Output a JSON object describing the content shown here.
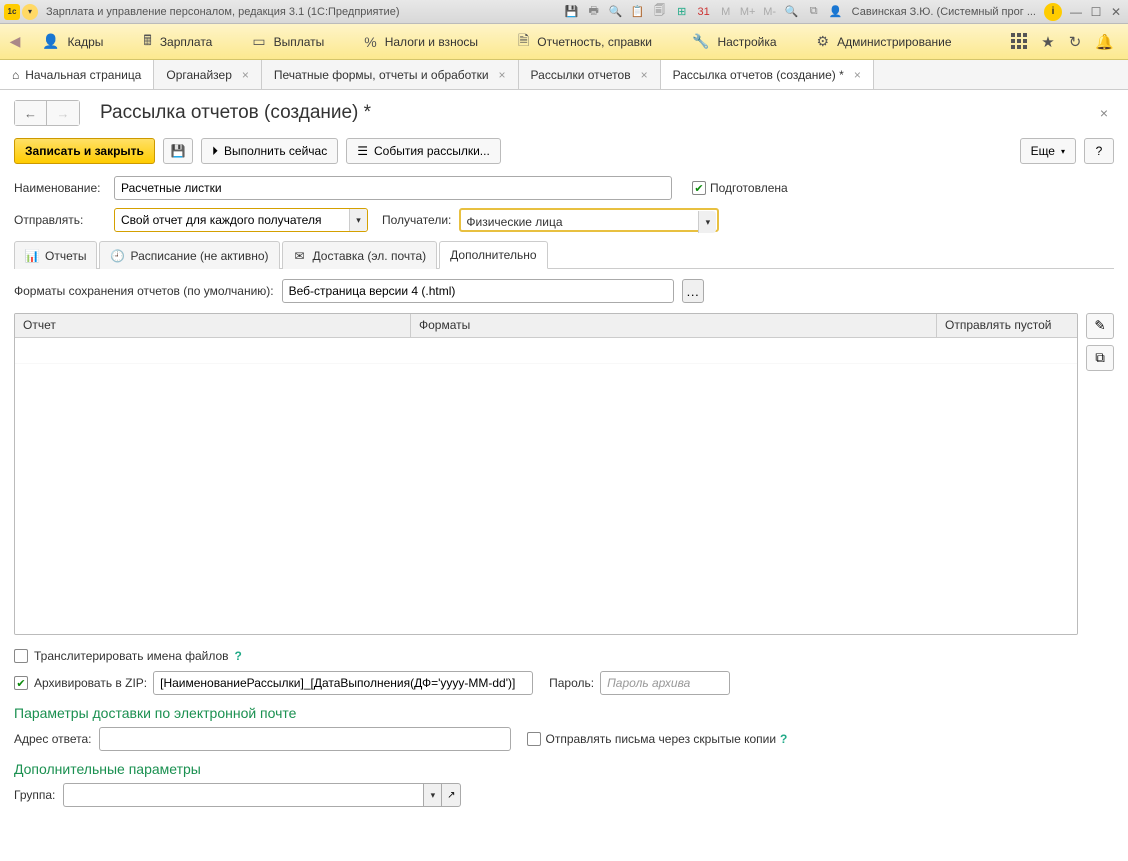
{
  "title_bar": {
    "app_title": "Зарплата и управление персоналом, редакция 3.1  (1С:Предприятие)",
    "user": "Савинская З.Ю. (Системный прог ..."
  },
  "menu": {
    "items": [
      "Кадры",
      "Зарплата",
      "Выплаты",
      "Налоги и взносы",
      "Отчетность, справки",
      "Настройка",
      "Администрирование"
    ]
  },
  "tabs": {
    "home": "Начальная страница",
    "items": [
      "Органайзер",
      "Печатные формы, отчеты и обработки",
      "Рассылки отчетов",
      "Рассылка отчетов (создание) *"
    ]
  },
  "header": {
    "page_title": "Рассылка отчетов (создание) *"
  },
  "toolbar": {
    "save_close": "Записать и закрыть",
    "run_now": "Выполнить сейчас",
    "events": "События рассылки...",
    "more": "Еще"
  },
  "form": {
    "name_label": "Наименование:",
    "name_value": "Расчетные листки",
    "prepared_label": "Подготовлена",
    "send_label": "Отправлять:",
    "send_value": "Свой отчет для каждого получателя",
    "recipients_label": "Получатели:",
    "recipients_value": "Физические лица"
  },
  "sub_tabs": {
    "reports": "Отчеты",
    "schedule": "Расписание (не активно)",
    "delivery": "Доставка (эл. почта)",
    "additional": "Дополнительно"
  },
  "additional": {
    "formats_label": "Форматы сохранения отчетов (по умолчанию):",
    "formats_value": "Веб-страница версии 4 (.html)",
    "table": {
      "col_report": "Отчет",
      "col_formats": "Форматы",
      "col_send_empty": "Отправлять пустой"
    },
    "translit": "Транслитерировать имена файлов",
    "archive_zip": "Архивировать в ZIP:",
    "archive_value": "[НаименованиеРассылки]_[ДатаВыполнения(ДФ='yyyy-MM-dd')]",
    "password_label": "Пароль:",
    "password_placeholder": "Пароль архива",
    "email_section": "Параметры доставки по электронной почте",
    "reply_label": "Адрес ответа:",
    "hidden_copies": "Отправлять письма через скрытые копии",
    "extra_section": "Дополнительные параметры",
    "group_label": "Группа:"
  }
}
